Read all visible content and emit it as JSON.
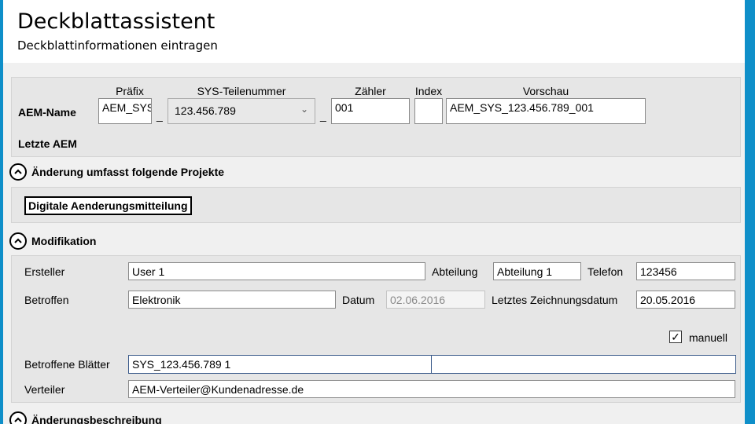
{
  "header": {
    "title": "Deckblattassistent",
    "subtitle": "Deckblattinformationen eintragen"
  },
  "aem": {
    "col_prefix": "Präfix",
    "col_sys": "SYS-Teilenummer",
    "col_counter": "Zähler",
    "col_index": "Index",
    "col_preview": "Vorschau",
    "label_name": "AEM-Name",
    "prefix_value": "AEM_SYS",
    "sep1": "_",
    "sys_value": "123.456.789",
    "sep2": "_",
    "counter_value": "001",
    "index_value": "",
    "preview_value": "AEM_SYS_123.456.789_001",
    "label_last": "Letzte AEM"
  },
  "projects": {
    "title": "Änderung umfasst folgende Projekte",
    "button_label": "Digitale Aenderungsmitteilung"
  },
  "modification": {
    "title": "Modifikation",
    "label_creator": "Ersteller",
    "creator_value": "User 1",
    "label_department": "Abteilung",
    "department_value": "Abteilung 1",
    "label_phone": "Telefon",
    "phone_value": "123456",
    "label_affected": "Betroffen",
    "affected_value": "Elektronik",
    "label_date": "Datum",
    "date_value": "02.06.2016",
    "label_last_drawing": "Letztes Zeichnungsdatum",
    "last_drawing_value": "20.05.2016",
    "manual_label": "manuell",
    "manual_checked": true,
    "label_sheets": "Betroffene Blätter",
    "sheets_value_1": "SYS_123.456.789 1",
    "sheets_value_2": "",
    "label_distribution": "Verteiler",
    "distribution_value": "AEM-Verteiler@Kundenadresse.de"
  },
  "description": {
    "title": "Änderungsbeschreibung"
  },
  "icons": {
    "chevron_up": "chevron-up-icon",
    "dropdown": "chevron-down-icon",
    "checkmark": "checkmark-icon"
  },
  "colors": {
    "frame_accent": "#0f8fc9",
    "content_bg": "#f0f0f0",
    "panel_bg": "#e6e6e6"
  }
}
